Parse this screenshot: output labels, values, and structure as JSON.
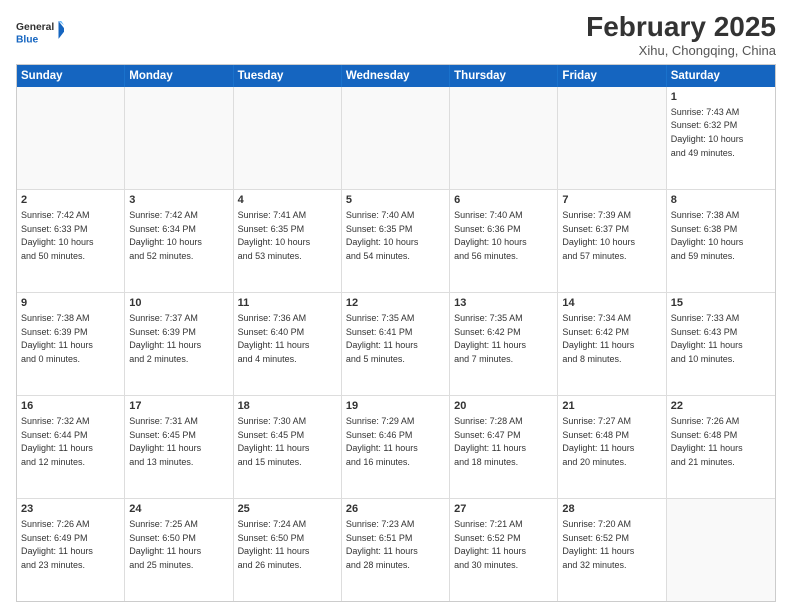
{
  "logo": {
    "general": "General",
    "blue": "Blue"
  },
  "title": "February 2025",
  "location": "Xihu, Chongqing, China",
  "header_days": [
    "Sunday",
    "Monday",
    "Tuesday",
    "Wednesday",
    "Thursday",
    "Friday",
    "Saturday"
  ],
  "weeks": [
    [
      {
        "day": "",
        "info": ""
      },
      {
        "day": "",
        "info": ""
      },
      {
        "day": "",
        "info": ""
      },
      {
        "day": "",
        "info": ""
      },
      {
        "day": "",
        "info": ""
      },
      {
        "day": "",
        "info": ""
      },
      {
        "day": "1",
        "info": "Sunrise: 7:43 AM\nSunset: 6:32 PM\nDaylight: 10 hours\nand 49 minutes."
      }
    ],
    [
      {
        "day": "2",
        "info": "Sunrise: 7:42 AM\nSunset: 6:33 PM\nDaylight: 10 hours\nand 50 minutes."
      },
      {
        "day": "3",
        "info": "Sunrise: 7:42 AM\nSunset: 6:34 PM\nDaylight: 10 hours\nand 52 minutes."
      },
      {
        "day": "4",
        "info": "Sunrise: 7:41 AM\nSunset: 6:35 PM\nDaylight: 10 hours\nand 53 minutes."
      },
      {
        "day": "5",
        "info": "Sunrise: 7:40 AM\nSunset: 6:35 PM\nDaylight: 10 hours\nand 54 minutes."
      },
      {
        "day": "6",
        "info": "Sunrise: 7:40 AM\nSunset: 6:36 PM\nDaylight: 10 hours\nand 56 minutes."
      },
      {
        "day": "7",
        "info": "Sunrise: 7:39 AM\nSunset: 6:37 PM\nDaylight: 10 hours\nand 57 minutes."
      },
      {
        "day": "8",
        "info": "Sunrise: 7:38 AM\nSunset: 6:38 PM\nDaylight: 10 hours\nand 59 minutes."
      }
    ],
    [
      {
        "day": "9",
        "info": "Sunrise: 7:38 AM\nSunset: 6:39 PM\nDaylight: 11 hours\nand 0 minutes."
      },
      {
        "day": "10",
        "info": "Sunrise: 7:37 AM\nSunset: 6:39 PM\nDaylight: 11 hours\nand 2 minutes."
      },
      {
        "day": "11",
        "info": "Sunrise: 7:36 AM\nSunset: 6:40 PM\nDaylight: 11 hours\nand 4 minutes."
      },
      {
        "day": "12",
        "info": "Sunrise: 7:35 AM\nSunset: 6:41 PM\nDaylight: 11 hours\nand 5 minutes."
      },
      {
        "day": "13",
        "info": "Sunrise: 7:35 AM\nSunset: 6:42 PM\nDaylight: 11 hours\nand 7 minutes."
      },
      {
        "day": "14",
        "info": "Sunrise: 7:34 AM\nSunset: 6:42 PM\nDaylight: 11 hours\nand 8 minutes."
      },
      {
        "day": "15",
        "info": "Sunrise: 7:33 AM\nSunset: 6:43 PM\nDaylight: 11 hours\nand 10 minutes."
      }
    ],
    [
      {
        "day": "16",
        "info": "Sunrise: 7:32 AM\nSunset: 6:44 PM\nDaylight: 11 hours\nand 12 minutes."
      },
      {
        "day": "17",
        "info": "Sunrise: 7:31 AM\nSunset: 6:45 PM\nDaylight: 11 hours\nand 13 minutes."
      },
      {
        "day": "18",
        "info": "Sunrise: 7:30 AM\nSunset: 6:45 PM\nDaylight: 11 hours\nand 15 minutes."
      },
      {
        "day": "19",
        "info": "Sunrise: 7:29 AM\nSunset: 6:46 PM\nDaylight: 11 hours\nand 16 minutes."
      },
      {
        "day": "20",
        "info": "Sunrise: 7:28 AM\nSunset: 6:47 PM\nDaylight: 11 hours\nand 18 minutes."
      },
      {
        "day": "21",
        "info": "Sunrise: 7:27 AM\nSunset: 6:48 PM\nDaylight: 11 hours\nand 20 minutes."
      },
      {
        "day": "22",
        "info": "Sunrise: 7:26 AM\nSunset: 6:48 PM\nDaylight: 11 hours\nand 21 minutes."
      }
    ],
    [
      {
        "day": "23",
        "info": "Sunrise: 7:26 AM\nSunset: 6:49 PM\nDaylight: 11 hours\nand 23 minutes."
      },
      {
        "day": "24",
        "info": "Sunrise: 7:25 AM\nSunset: 6:50 PM\nDaylight: 11 hours\nand 25 minutes."
      },
      {
        "day": "25",
        "info": "Sunrise: 7:24 AM\nSunset: 6:50 PM\nDaylight: 11 hours\nand 26 minutes."
      },
      {
        "day": "26",
        "info": "Sunrise: 7:23 AM\nSunset: 6:51 PM\nDaylight: 11 hours\nand 28 minutes."
      },
      {
        "day": "27",
        "info": "Sunrise: 7:21 AM\nSunset: 6:52 PM\nDaylight: 11 hours\nand 30 minutes."
      },
      {
        "day": "28",
        "info": "Sunrise: 7:20 AM\nSunset: 6:52 PM\nDaylight: 11 hours\nand 32 minutes."
      },
      {
        "day": "",
        "info": ""
      }
    ]
  ]
}
